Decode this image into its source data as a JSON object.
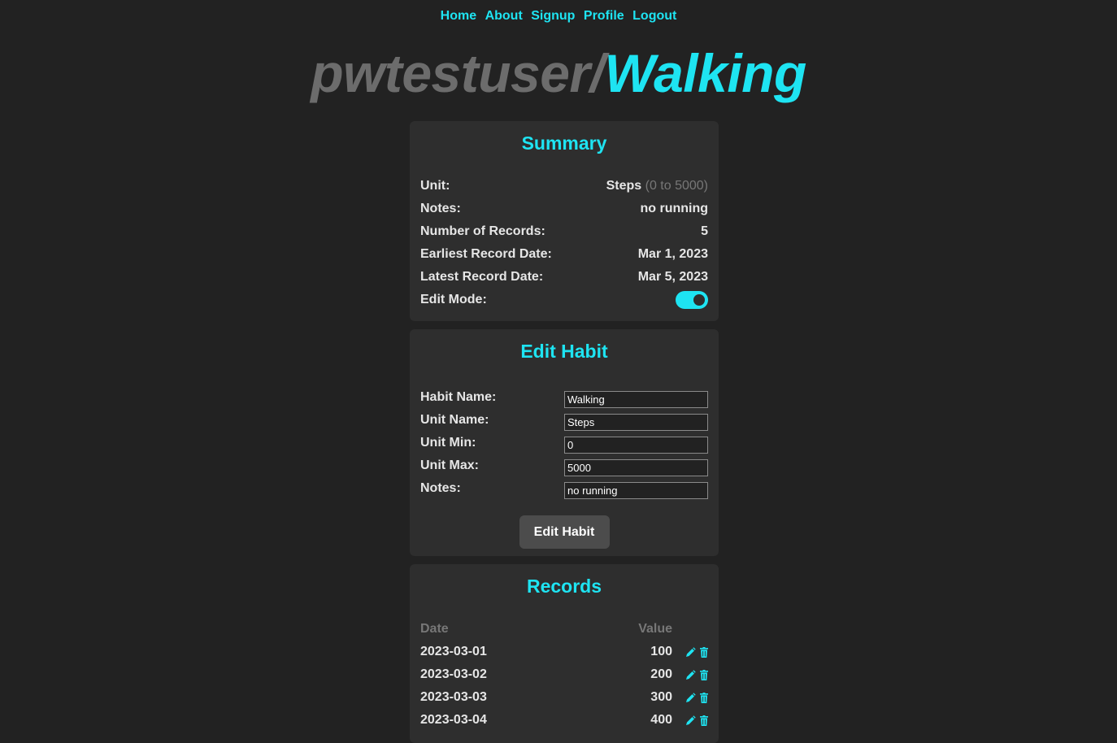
{
  "nav": {
    "items": [
      "Home",
      "About",
      "Signup",
      "Profile",
      "Logout"
    ]
  },
  "title": {
    "user": "pwtestuser/",
    "habit": "Walking"
  },
  "summary": {
    "heading": "Summary",
    "unit_label": "Unit:",
    "unit_value": "Steps",
    "unit_range": "(0 to 5000)",
    "notes_label": "Notes:",
    "notes_value": "no running",
    "count_label": "Number of Records:",
    "count_value": "5",
    "earliest_label": "Earliest Record Date:",
    "earliest_value": "Mar 1, 2023",
    "latest_label": "Latest Record Date:",
    "latest_value": "Mar 5, 2023",
    "edit_mode_label": "Edit Mode:",
    "edit_mode_on": true
  },
  "edit_habit": {
    "heading": "Edit Habit",
    "fields": [
      {
        "label": "Habit Name:",
        "value": "Walking"
      },
      {
        "label": "Unit Name:",
        "value": "Steps"
      },
      {
        "label": "Unit Min:",
        "value": "0"
      },
      {
        "label": "Unit Max:",
        "value": "5000"
      },
      {
        "label": "Notes:",
        "value": "no running"
      }
    ],
    "button_label": "Edit Habit"
  },
  "records": {
    "heading": "Records",
    "col_date": "Date",
    "col_value": "Value",
    "rows": [
      {
        "date": "2023-03-01",
        "value": "100"
      },
      {
        "date": "2023-03-02",
        "value": "200"
      },
      {
        "date": "2023-03-03",
        "value": "300"
      },
      {
        "date": "2023-03-04",
        "value": "400"
      }
    ]
  },
  "colors": {
    "accent": "#1ee4f2",
    "background": "#222222",
    "card": "#2e2e2e",
    "muted": "#6c6c6c"
  },
  "icons": {
    "edit": "pencil-icon",
    "delete": "trash-icon"
  }
}
